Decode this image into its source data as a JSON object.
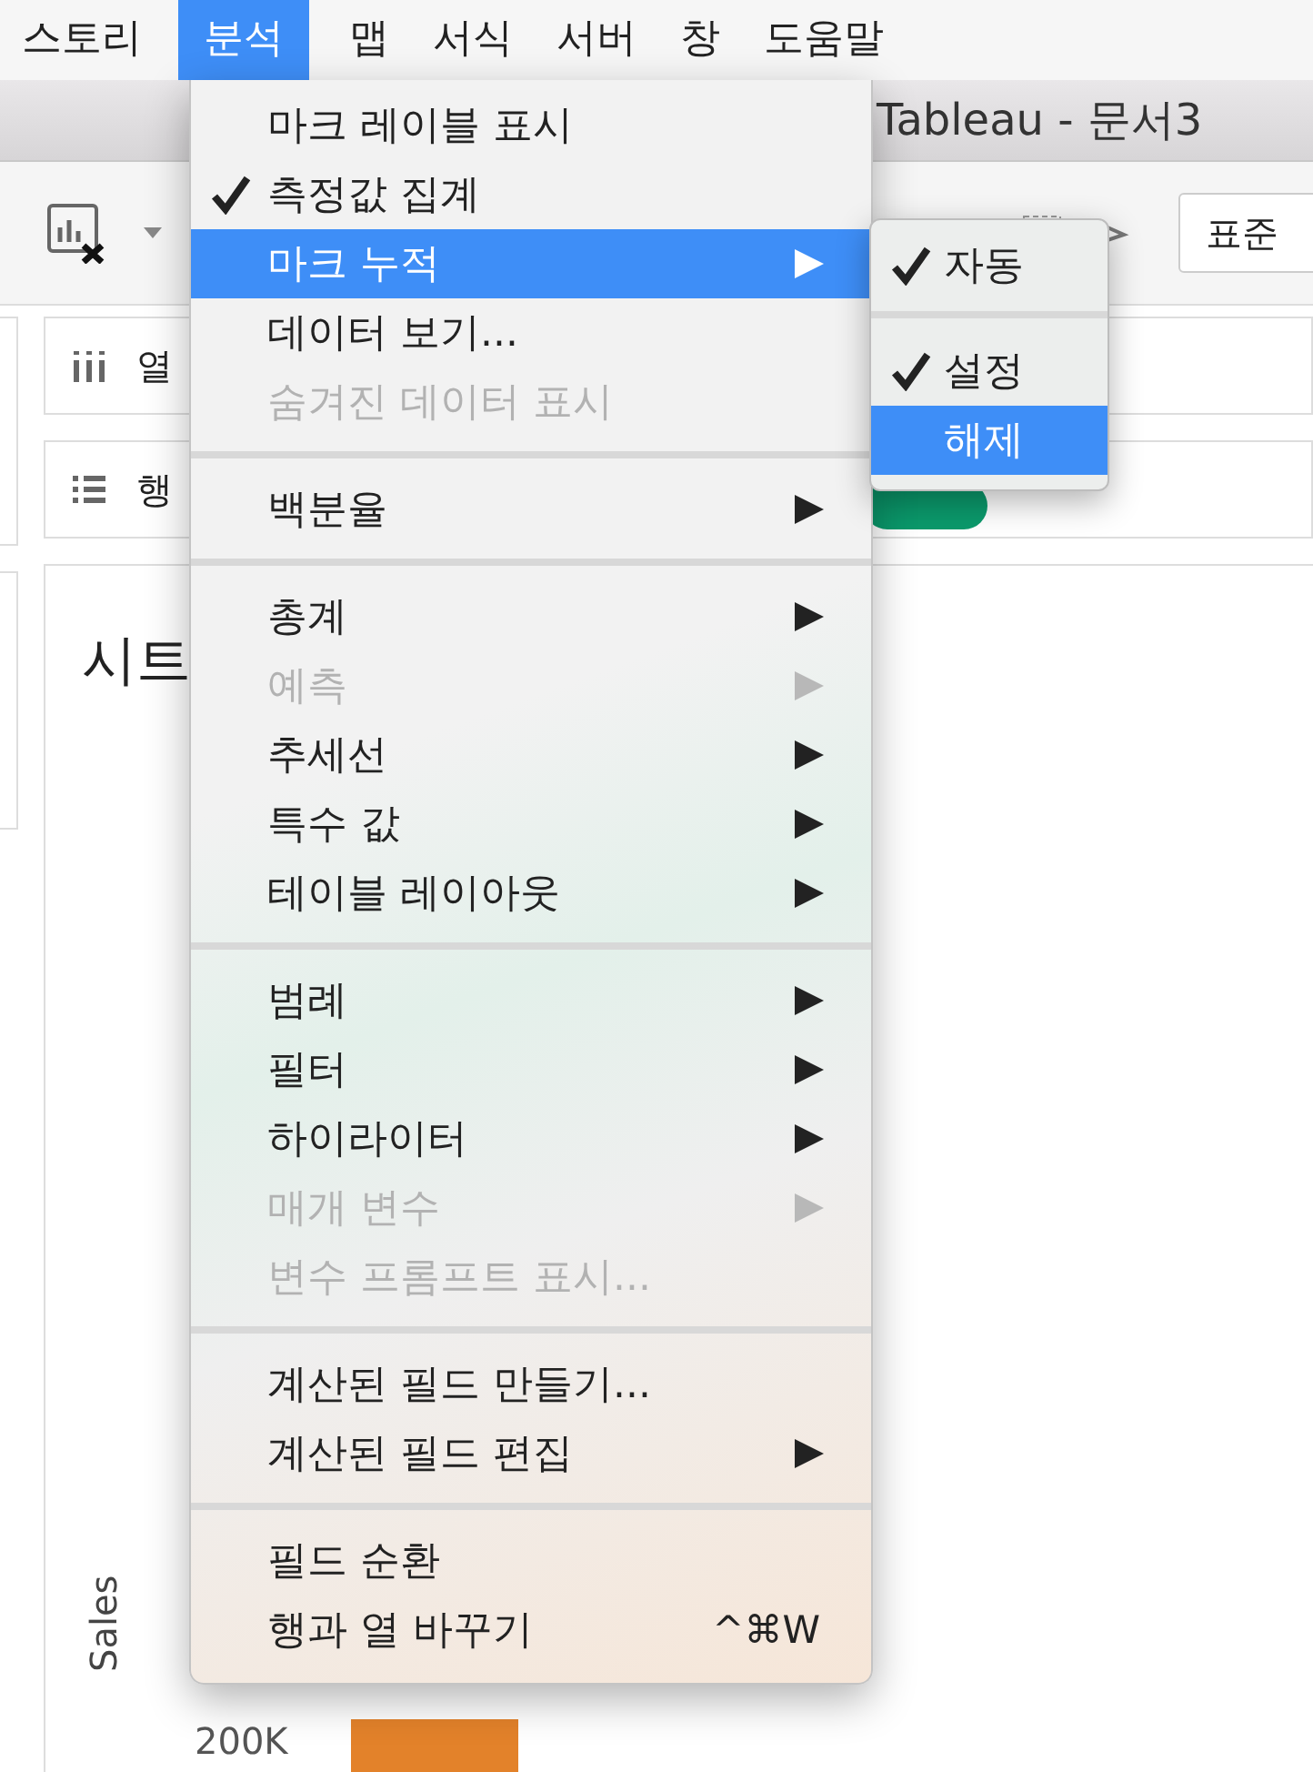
{
  "menu_bar": [
    {
      "label": "스토리",
      "selected": false
    },
    {
      "label": "분석",
      "selected": true
    },
    {
      "label": "맵",
      "selected": false
    },
    {
      "label": "서식",
      "selected": false
    },
    {
      "label": "서버",
      "selected": false
    },
    {
      "label": "창",
      "selected": false
    },
    {
      "label": "도움말",
      "selected": false
    }
  ],
  "window": {
    "title": "Tableau - 문서3"
  },
  "toolbar": {
    "fit_dropdown": "표준"
  },
  "shelves": [
    {
      "kind": "columns",
      "label": "열"
    },
    {
      "kind": "rows",
      "label": "행"
    }
  ],
  "sheet": {
    "title": "시트",
    "axis_label": "Sales",
    "tick": "200K"
  },
  "menu": [
    {
      "kind": "item",
      "label": "마크 레이블 표시",
      "checked": false,
      "disabled": false,
      "selected": false,
      "submenu": false
    },
    {
      "kind": "item",
      "label": "측정값 집계",
      "checked": true,
      "disabled": false,
      "selected": false,
      "submenu": false
    },
    {
      "kind": "item",
      "label": "마크 누적",
      "checked": false,
      "disabled": false,
      "selected": true,
      "submenu": true
    },
    {
      "kind": "item",
      "label": "데이터 보기...",
      "checked": false,
      "disabled": false,
      "selected": false,
      "submenu": false
    },
    {
      "kind": "item",
      "label": "숨겨진 데이터 표시",
      "checked": false,
      "disabled": true,
      "selected": false,
      "submenu": false
    },
    {
      "kind": "separator"
    },
    {
      "kind": "item",
      "label": "백분율",
      "checked": false,
      "disabled": false,
      "selected": false,
      "submenu": true
    },
    {
      "kind": "separator"
    },
    {
      "kind": "item",
      "label": "총계",
      "checked": false,
      "disabled": false,
      "selected": false,
      "submenu": true
    },
    {
      "kind": "item",
      "label": "예측",
      "checked": false,
      "disabled": true,
      "selected": false,
      "submenu": true
    },
    {
      "kind": "item",
      "label": "추세선",
      "checked": false,
      "disabled": false,
      "selected": false,
      "submenu": true
    },
    {
      "kind": "item",
      "label": "특수 값",
      "checked": false,
      "disabled": false,
      "selected": false,
      "submenu": true
    },
    {
      "kind": "item",
      "label": "테이블 레이아웃",
      "checked": false,
      "disabled": false,
      "selected": false,
      "submenu": true
    },
    {
      "kind": "separator"
    },
    {
      "kind": "item",
      "label": "범례",
      "checked": false,
      "disabled": false,
      "selected": false,
      "submenu": true
    },
    {
      "kind": "item",
      "label": "필터",
      "checked": false,
      "disabled": false,
      "selected": false,
      "submenu": true
    },
    {
      "kind": "item",
      "label": "하이라이터",
      "checked": false,
      "disabled": false,
      "selected": false,
      "submenu": true
    },
    {
      "kind": "item",
      "label": "매개 변수",
      "checked": false,
      "disabled": true,
      "selected": false,
      "submenu": true
    },
    {
      "kind": "item",
      "label": "변수 프롬프트 표시...",
      "checked": false,
      "disabled": true,
      "selected": false,
      "submenu": false
    },
    {
      "kind": "separator"
    },
    {
      "kind": "item",
      "label": "계산된 필드 만들기...",
      "checked": false,
      "disabled": false,
      "selected": false,
      "submenu": false
    },
    {
      "kind": "item",
      "label": "계산된 필드 편집",
      "checked": false,
      "disabled": false,
      "selected": false,
      "submenu": true
    },
    {
      "kind": "separator"
    },
    {
      "kind": "item",
      "label": "필드 순환",
      "checked": false,
      "disabled": false,
      "selected": false,
      "submenu": false
    },
    {
      "kind": "item",
      "label": "행과 열 바꾸기",
      "checked": false,
      "disabled": false,
      "selected": false,
      "submenu": false,
      "shortcut": "^⌘W"
    }
  ],
  "submenu": [
    {
      "kind": "item",
      "label": "자동",
      "checked": true,
      "selected": false
    },
    {
      "kind": "separator"
    },
    {
      "kind": "item",
      "label": "설정",
      "checked": true,
      "selected": false
    },
    {
      "kind": "item",
      "label": "해제",
      "checked": false,
      "selected": true
    }
  ]
}
